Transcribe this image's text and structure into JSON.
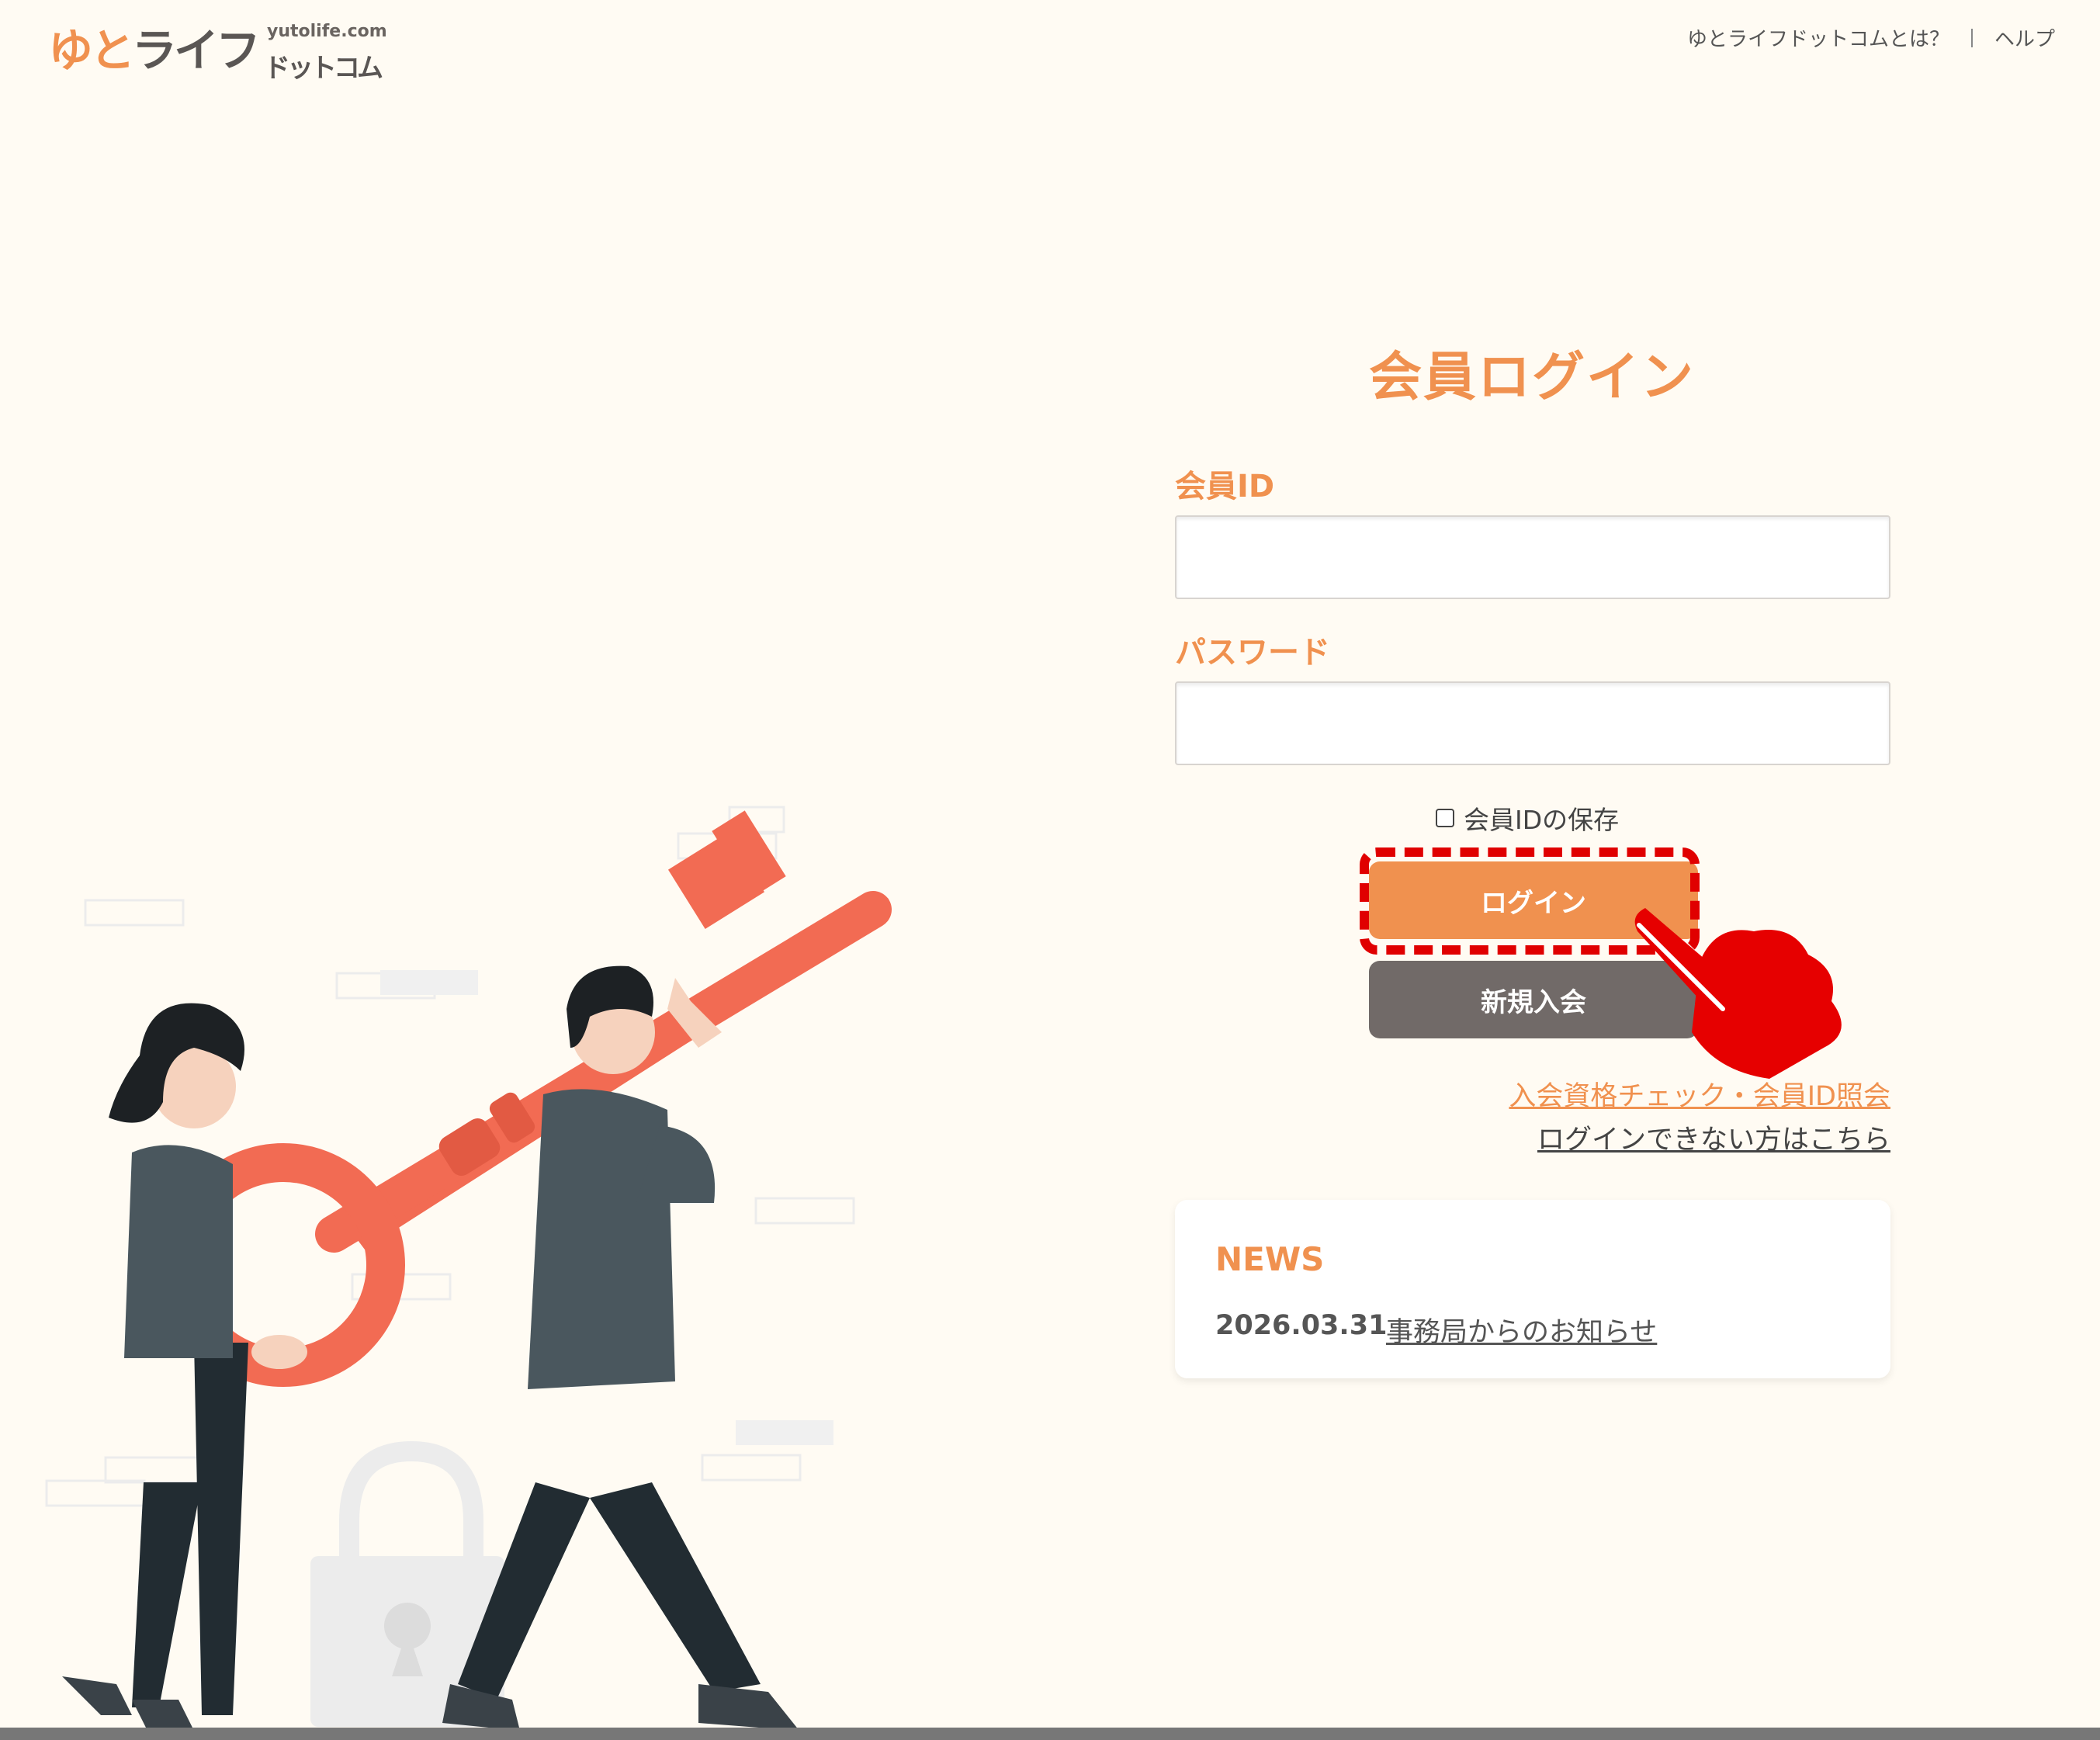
{
  "header": {
    "logo_main_part1": "ゆと",
    "logo_main_part2": "ライフ",
    "logo_sub": "ドットコム",
    "logo_url": "yutolife.com",
    "nav": [
      {
        "label": "ゆとライフドットコムとは？"
      },
      {
        "label": "ヘルプ"
      }
    ]
  },
  "login": {
    "title": "会員ログイン",
    "member_id_label": "会員ID",
    "member_id_value": "",
    "password_label": "パスワード",
    "password_value": "",
    "remember_label": "会員IDの保存",
    "remember_checked": false,
    "login_button": "ログイン",
    "join_button": "新規入会",
    "link_check": "入会資格チェック・会員ID照会",
    "link_help": "ログインできない方はこちら"
  },
  "news": {
    "title": "NEWS",
    "items": [
      {
        "date": "2026.03.31",
        "text": "事務局からのお知らせ"
      }
    ]
  },
  "colors": {
    "accent": "#f0914f",
    "dark_button": "#716a68",
    "background": "#fffbf3",
    "annotation": "#e00000",
    "key": "#f26b53"
  },
  "icons": {
    "pointer_hand": "pointing-hand-icon",
    "checkbox": "checkbox-icon"
  }
}
